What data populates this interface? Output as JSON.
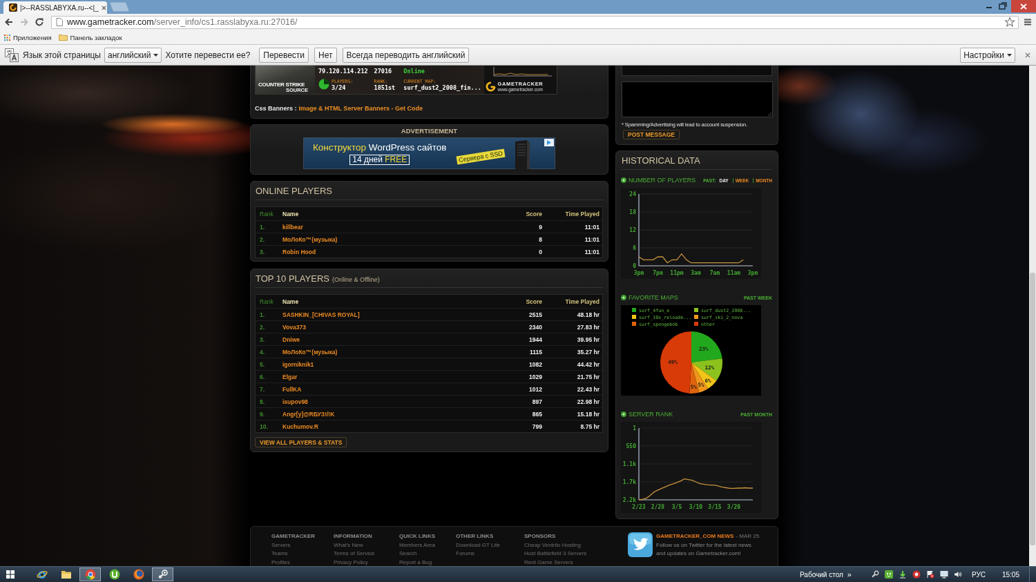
{
  "browser": {
    "tab": {
      "title": "|>--RASSLABYXA.ru--<|_",
      "selected": true
    },
    "address": {
      "host": "www.gametracker.com",
      "path": "/server_info/cs1.rasslabyxa.ru:27016/"
    },
    "bookmarks": [
      {
        "kind": "apps",
        "label": "Приложения"
      },
      {
        "kind": "folder",
        "label": "Панель закладок"
      }
    ],
    "translate_bar": {
      "prompt": "Язык этой страницы",
      "language": "английский",
      "question": "Хотите перевести ее?",
      "buttons": [
        "Перевести",
        "Нет",
        "Всегда переводить английский"
      ],
      "settings": "Настройки"
    }
  },
  "server_banner": {
    "game_logo": "COUNTER STRIKE",
    "game_logo_sub": "SOURCE",
    "ip": "79.120.114.212",
    "port": "27016",
    "status": "Online",
    "players_label": "PLAYERS:",
    "players": "3/24",
    "rank_label": "RANK:",
    "rank": "1851st",
    "map_label": "CURRENT MAP:",
    "map": "surf_dust2_2008_fin...",
    "logo": "GAMETRACKER",
    "logo_url": "www.gametracker.com",
    "links_label": "Css Banners :",
    "link": "Image & HTML Server Banners - Get Code"
  },
  "advertisement": {
    "heading": "ADVERTISEMENT",
    "headline_highlight": "Конструктор",
    "headline_rest": "WordPress сайтов",
    "offer": "14 дней",
    "offer_highlight": "FREE",
    "badge": "Сервера с SSD"
  },
  "online_players": {
    "title": "ONLINE PLAYERS",
    "columns": [
      "Rank",
      "Name",
      "Score",
      "Time Played"
    ],
    "rows": [
      {
        "rank": "1.",
        "name": "killbear",
        "score": "9",
        "time": "11:01"
      },
      {
        "rank": "2.",
        "name": "МоЛоКо™(музыка)",
        "score": "8",
        "time": "11:01"
      },
      {
        "rank": "3.",
        "name": "Robin Hood",
        "score": "0",
        "time": "11:01"
      }
    ]
  },
  "top_players": {
    "title": "TOP 10 PLAYERS",
    "subtitle": "(Online & Offline)",
    "columns": [
      "Rank",
      "Name",
      "Score",
      "Time Played"
    ],
    "rows": [
      {
        "rank": "1.",
        "name": "SASHKIN_[CHIVAS ROYAL]",
        "score": "2515",
        "time": "48.18 hr"
      },
      {
        "rank": "2.",
        "name": "Vova373",
        "score": "2340",
        "time": "27.83 hr"
      },
      {
        "rank": "3.",
        "name": "Dniwe",
        "score": "1944",
        "time": "39.95 hr"
      },
      {
        "rank": "4.",
        "name": "МоЛоКо™(музыка)",
        "score": "1115",
        "time": "35.27 hr"
      },
      {
        "rank": "5.",
        "name": "igorniknik1",
        "score": "1082",
        "time": "44.42 hr"
      },
      {
        "rank": "6.",
        "name": "Elgar",
        "score": "1029",
        "time": "21.75 hr"
      },
      {
        "rank": "7.",
        "name": "FullKA",
        "score": "1012",
        "time": "22.43 hr"
      },
      {
        "rank": "8.",
        "name": "isupov98",
        "score": "897",
        "time": "22.98 hr"
      },
      {
        "rank": "9.",
        "name": "Angr[y]@RБУЗ!/!K",
        "score": "865",
        "time": "15.18 hr"
      },
      {
        "rank": "10.",
        "name": "Kuchumov.R",
        "score": "799",
        "time": "8.75 hr"
      }
    ],
    "button": "VIEW ALL PLAYERS & STATS"
  },
  "message_form": {
    "note": "* Spamming/Advertising will lead to account suspension.",
    "button": "POST MESSAGE"
  },
  "historical": {
    "title": "HISTORICAL DATA",
    "sections": [
      {
        "title": "NUMBER OF PLAYERS",
        "range_label": "PAST:",
        "ranges": [
          {
            "label": "DAY",
            "selected": true
          },
          {
            "label": "WEEK",
            "selected": false
          },
          {
            "label": "MONTH",
            "selected": false
          }
        ],
        "chart_data": {
          "type": "line",
          "categories": [
            "3pm",
            null,
            null,
            null,
            "7pm",
            null,
            null,
            null,
            "11pm",
            null,
            null,
            null,
            "3am",
            null,
            null,
            null,
            "7am",
            null,
            null,
            null,
            "11am",
            null,
            null,
            null,
            "3pm"
          ],
          "series": [
            {
              "color": "#c8923c",
              "values": [
                3,
                2,
                2,
                2,
                3,
                3,
                1,
                2,
                2,
                4,
                2,
                1,
                1,
                1,
                1,
                1,
                1,
                1,
                1,
                1,
                1,
                1,
                2,
                null,
                null
              ]
            }
          ],
          "ylim": [
            0,
            24
          ],
          "yticks": [
            0,
            6,
            12,
            18,
            24
          ],
          "grid": true
        }
      },
      {
        "title": "FAVORITE MAPS",
        "range": "PAST WEEK",
        "chart_data": {
          "type": "pie",
          "categories": [
            "surf_4fun_e",
            "surf_dust2_2008...",
            "surf_10x_reloade...",
            "surf_ski_2_nova",
            "surf_spongebob",
            "other"
          ],
          "series": [
            {
              "values": [
                23,
                12,
                6,
                5,
                5,
                49
              ]
            }
          ],
          "colors": [
            "#22a81c",
            "#8cc21e",
            "#f2c418",
            "#f0961c",
            "#e0640e",
            "#d83a08"
          ],
          "value_labels": [
            "23%",
            "12%",
            "6%",
            "5%",
            "5%",
            "49%"
          ],
          "legend": "top"
        }
      },
      {
        "title": "SERVER RANK",
        "range": "PAST MONTH",
        "chart_data": {
          "type": "line",
          "categories": [
            "2/23",
            null,
            null,
            null,
            null,
            "2/28",
            null,
            null,
            null,
            null,
            "3/5",
            null,
            null,
            null,
            null,
            "3/10",
            null,
            null,
            null,
            null,
            "3/15",
            null,
            null,
            null,
            null,
            "3/20",
            null,
            null,
            null,
            null,
            null
          ],
          "series": [
            {
              "color": "#c8923c",
              "values": [
                2200,
                2180,
                2150,
                2060,
                1960,
                1900,
                1850,
                1800,
                1750,
                1710,
                1670,
                1620,
                1560,
                1580,
                1600,
                1650,
                1700,
                1720,
                1740,
                1750,
                1750,
                1780,
                1810,
                1830,
                1850,
                1850,
                1840,
                1840,
                1830,
                1840,
                1840
              ]
            }
          ],
          "ylim": [
            2200,
            1
          ],
          "yticks": [
            {
              "value": 1,
              "label": "1"
            },
            {
              "value": 550,
              "label": "550"
            },
            {
              "value": 1100,
              "label": "1.1k"
            },
            {
              "value": 1650,
              "label": "1.7k"
            },
            {
              "value": 2200,
              "label": "2.2k"
            }
          ],
          "grid": true
        }
      }
    ]
  },
  "footer": {
    "columns": [
      {
        "heading": "GAMETRACKER",
        "links": [
          "Servers",
          "Teams",
          "Profiles"
        ]
      },
      {
        "heading": "INFORMATION",
        "links": [
          "What's New",
          "Terms of Service",
          "Privacy Policy"
        ]
      },
      {
        "heading": "QUICK LINKS",
        "links": [
          "Members Area",
          "Search",
          "Report a Bug"
        ]
      },
      {
        "heading": "OTHER LINKS",
        "links": [
          "Download GT Lite",
          "Forums"
        ]
      },
      {
        "heading": "SPONSORS",
        "links": [
          "Cheap Ventrilo Hosting",
          "Host Battlefield 3 Servers",
          "Rent Game Servers"
        ]
      }
    ],
    "news": {
      "title": "GAMETRACKER_COM NEWS",
      "date": "- MAR 25",
      "text": "Follow us on Twitter for the latest news and updates on Gametracker.com!"
    }
  },
  "taskbar": {
    "apps": [
      {
        "kind": "ie",
        "selected": false
      },
      {
        "kind": "explorer",
        "selected": false
      },
      {
        "kind": "chrome",
        "selected": true
      },
      {
        "kind": "utorrent",
        "selected": false
      },
      {
        "kind": "firefox",
        "selected": false
      },
      {
        "kind": "steam",
        "selected": true
      }
    ],
    "toolbar": "Рабочий стол",
    "chevron": "»",
    "language": "РУС",
    "clock": "15:05"
  }
}
